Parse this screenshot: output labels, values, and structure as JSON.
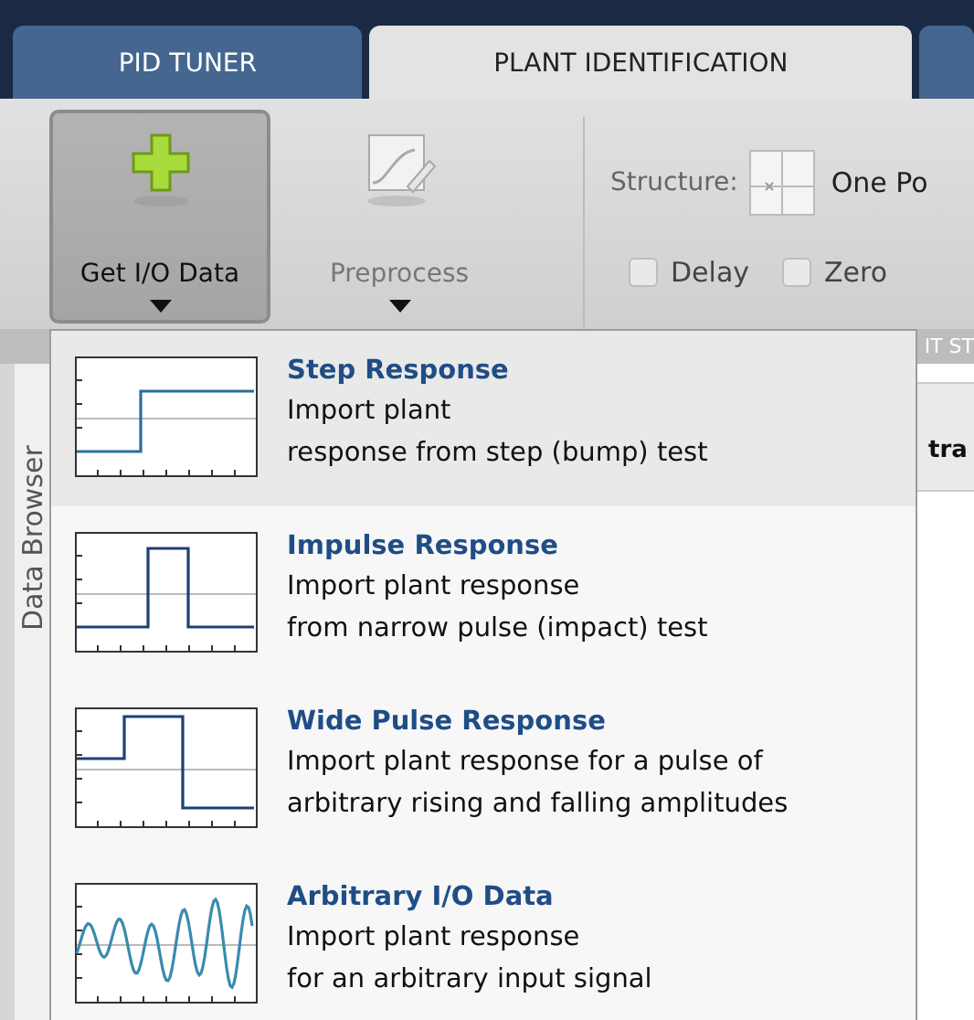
{
  "tabs": [
    {
      "label": "PID TUNER",
      "selected": false
    },
    {
      "label": "PLANT IDENTIFICATION",
      "selected": true
    }
  ],
  "toolstrip": {
    "get_data": {
      "label": "Get I/O Data",
      "pressed": true
    },
    "preprocess": {
      "label": "Preprocess",
      "disabled": true
    },
    "structure_label": "Structure:",
    "structure_value": "One Po",
    "checkboxes": [
      {
        "label": "Delay",
        "checked": false
      },
      {
        "label": "Zero",
        "checked": false
      }
    ],
    "section_label": "IT ST"
  },
  "sidebar": {
    "label": "Data Browser"
  },
  "content": {
    "column_label": "tra"
  },
  "menu": {
    "items": [
      {
        "kind": "step",
        "title": "Step Response",
        "lines": [
          "Import plant",
          "response from step (bump) test"
        ],
        "selected": true
      },
      {
        "kind": "impulse",
        "title": "Impulse Response",
        "lines": [
          "Import plant response",
          "from narrow pulse (impact) test"
        ],
        "selected": false
      },
      {
        "kind": "wide_pulse",
        "title": "Wide Pulse Response",
        "lines": [
          "Import plant response for a pulse of",
          "arbitrary rising and falling amplitudes"
        ],
        "selected": false
      },
      {
        "kind": "arbitrary",
        "title": "Arbitrary I/O Data",
        "lines": [
          "Import plant response",
          "for an arbitrary input signal"
        ],
        "selected": false
      }
    ]
  }
}
